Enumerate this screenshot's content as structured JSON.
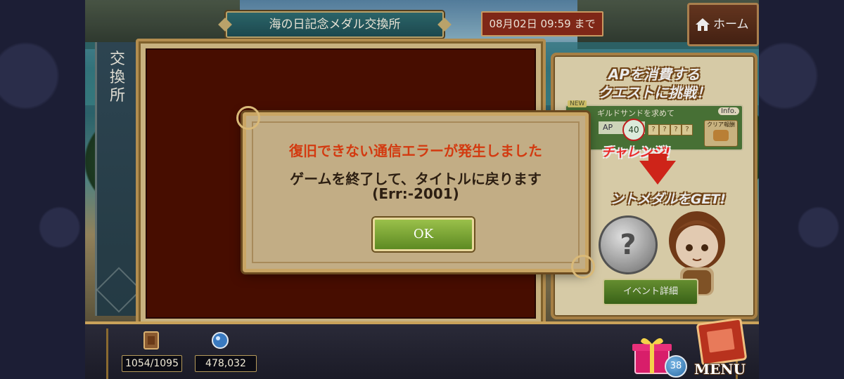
{
  "header": {
    "title": "海の日記念メダル交換所",
    "timer": "08月02日 09:59 まで",
    "home_label": "ホーム"
  },
  "sidebar": {
    "label_chars": [
      "交",
      "換",
      "所"
    ]
  },
  "promo": {
    "headline_line1": "APを消費する",
    "headline_line2": "クエストに挑戦！",
    "quest_name": "ギルドサンドを求めて",
    "quest_new": "NEW",
    "quest_info": "Info.",
    "quest_ap_label": "AP",
    "quest_ap_value": "40",
    "quest_clear_label": "クリア報酬",
    "challenge": "チャレンジ!",
    "get_text": "ントメダルをGET!",
    "medal_glyph": "?",
    "event_button": "イベント詳細"
  },
  "dialog": {
    "title": "復旧できない通信エラーが発生しました",
    "message": "ゲームを終了して、タイトルに戻ります",
    "code": "(Err:-2001)",
    "ok_label": "OK"
  },
  "bottom_bar": {
    "ap": "1054/1095",
    "currency": "478,032",
    "gift_count": "38",
    "menu_label": "MENU"
  },
  "colors": {
    "error_title": "#d33a10",
    "timer_bg": "#8a2b1a",
    "ok_button": "#7aa838",
    "panel_bg": "#4e0f00"
  },
  "icons": {
    "home": "house-icon",
    "ap": "card-icon",
    "currency": "orb-icon",
    "gift": "gift-icon",
    "menu": "book-icon"
  }
}
